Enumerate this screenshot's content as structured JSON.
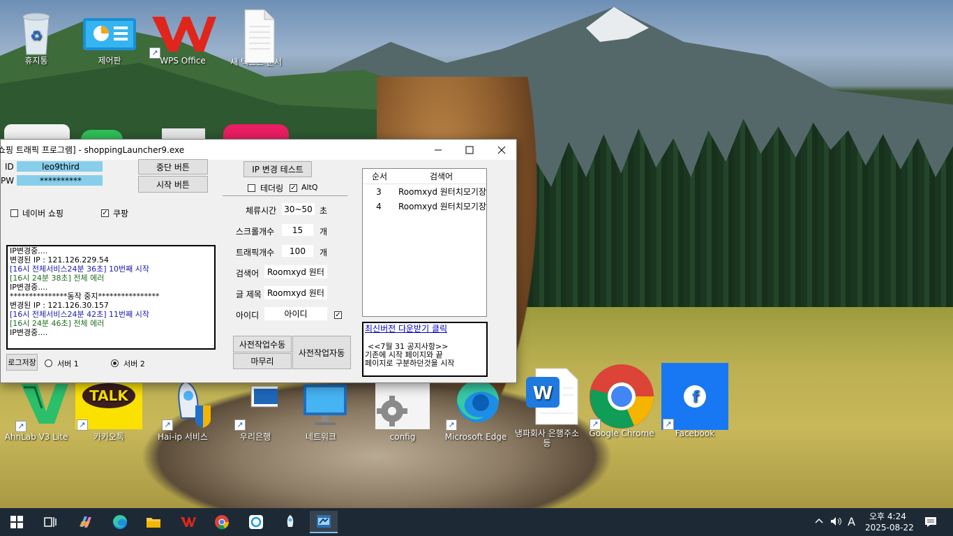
{
  "desktop": {
    "top_icons": [
      {
        "label": "휴지통"
      },
      {
        "label": "제어판"
      },
      {
        "label": "WPS Office"
      },
      {
        "label": "새 텍스트 문서"
      }
    ],
    "bottom_icons": [
      {
        "label": "AhnLab V3 Lite"
      },
      {
        "label": "카카오톡"
      },
      {
        "label": "Hai-ip 서비스"
      },
      {
        "label": "우리은행"
      },
      {
        "label": "네트워크"
      },
      {
        "label": "config"
      },
      {
        "label": "Microsoft Edge"
      },
      {
        "label": "냉파회사 은행주소등"
      },
      {
        "label": "Google Chrome"
      },
      {
        "label": "Facebook"
      }
    ]
  },
  "window": {
    "title": "쇼핑 트래픽 프로그램] - shoppingLauncher9.exe",
    "id_label": "ID",
    "id_value": "leo9third",
    "pw_label": "PW",
    "pw_value": "**********",
    "stop_button": "중단 버튼",
    "start_button": "시작 버튼",
    "ip_test_button": "IP 변경 테스트",
    "tethering_label": "테더링",
    "altq_label": "AltQ",
    "naver_label": "네이버 쇼핑",
    "coupang_label": "쿠팡",
    "stay_time_label": "체류시간",
    "stay_time_value": "30~50",
    "stay_time_unit": "초",
    "scroll_label": "스크롤개수",
    "scroll_value": "15",
    "scroll_unit": "개",
    "traffic_label": "트래픽개수",
    "traffic_value": "100",
    "traffic_unit": "개",
    "keyword_label": "검색어",
    "keyword_value": "Roomxyd 원터",
    "post_title_label": "글 제목",
    "post_title_value": "Roomxyd 원터",
    "account_label": "아이디",
    "account_value": "아이디",
    "log_lines": [
      {
        "text": "IP변경중....",
        "color": "black"
      },
      {
        "text": "변경된 IP : 121.126.229.54",
        "color": "black"
      },
      {
        "text": "[16시 전체서비스24분 36초] 10번째 시작",
        "color": "blue"
      },
      {
        "text": "[16시 24분 38초] 전체 에러",
        "color": "green"
      },
      {
        "text": "IP변경중....",
        "color": "black"
      },
      {
        "text": "***************동작 중지****************",
        "color": "black"
      },
      {
        "text": "변경된 IP : 121.126.30.157",
        "color": "black"
      },
      {
        "text": "[16시 전체서비스24분 42초] 11번째 시작",
        "color": "blue"
      },
      {
        "text": "[16시 24분 46초] 전체 에러",
        "color": "green"
      },
      {
        "text": "IP변경중....",
        "color": "black"
      }
    ],
    "log_save_button": "로그저장",
    "server1_label": "서버 1",
    "server2_label": "서버 2",
    "pre_manual_button": "사전작업수동",
    "finish_button": "마무리",
    "pre_auto_button": "사전작업자동",
    "table": {
      "headers": [
        "순서",
        "검색어"
      ],
      "rows": [
        {
          "num": "3",
          "keyword": "Roomxyd 원터치모기장"
        },
        {
          "num": "4",
          "keyword": "Roomxyd 원터치모기장"
        }
      ]
    },
    "notice": {
      "link": "최신버전 다운받기 클릭",
      "line1": "<<7월 31 공지사항>>",
      "line2": "기존에 시작 페이지와 끝",
      "line3": "페이지로 구분하던것을 시작"
    }
  },
  "taskbar": {
    "time": "오후 4:24",
    "date": "2025-08-22",
    "ime": "A"
  }
}
